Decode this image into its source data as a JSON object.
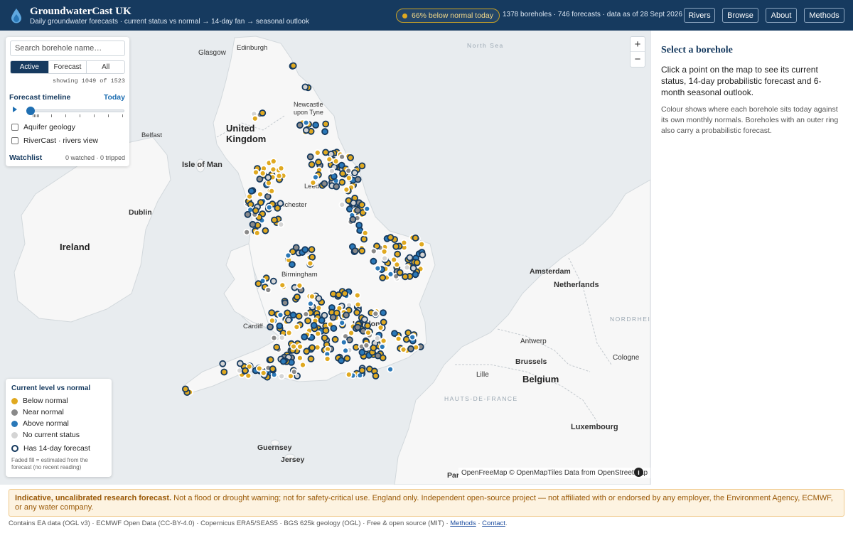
{
  "header": {
    "title": "GroundwaterCast UK",
    "subtitle": "Daily groundwater forecasts · current status vs normal → 14-day fan → seasonal outlook",
    "status_pill": "66% below normal today",
    "stats": "1378 boreholes · 746 forecasts · data as of 28 Sept 2026",
    "nav": [
      "Rivers",
      "Browse",
      "About",
      "Methods"
    ]
  },
  "colors": {
    "brand": "#163a5f",
    "below": "#e0a920",
    "near": "#8a8a8a",
    "above": "#2a78b8",
    "none": "#d4d4d4"
  },
  "panel": {
    "search_placeholder": "Search borehole name…",
    "tabs": [
      "Active",
      "Forecast",
      "All"
    ],
    "active_tab": "Active",
    "showing": "showing 1049 of 1523",
    "timeline_label": "Forecast timeline",
    "today_label": "Today",
    "layers": [
      "Aquifer geology",
      "RiverCast · rivers view"
    ],
    "watchlist_label": "Watchlist",
    "watchlist_counts": "0 watched · 0 tripped"
  },
  "legend": {
    "title": "Current level vs normal",
    "items": [
      "Below normal",
      "Near normal",
      "Above normal",
      "No current status"
    ],
    "ring_label": "Has 14-day forecast",
    "note": "Faded fill = estimated from the forecast (no recent reading)"
  },
  "map": {
    "labels": {
      "edinburgh": "Edinburgh",
      "glasgow": "Glasgow",
      "north_sea": "North Sea",
      "newcastle": "Newcastle upon Tyne",
      "belfast": "Belfast",
      "united_kingdom": "United Kingdom",
      "isle_of_man": "Isle of Man",
      "leeds": "Leeds",
      "manchester": "Manchester",
      "dublin": "Dublin",
      "ireland": "Ireland",
      "birmingham": "Birmingham",
      "amsterdam": "Amsterdam",
      "netherlands": "Netherlands",
      "cardiff": "Cardiff",
      "london": "London",
      "nordrhein": "NORDRHEIN-WESTFALEN",
      "antwerp": "Antwerp",
      "brussels": "Brussels",
      "cologne": "Cologne",
      "lille": "Lille",
      "belgium": "Belgium",
      "hauts_de_france": "HAUTS-DE-FRANCE",
      "luxembourg": "Luxembourg",
      "guernsey": "Guernsey",
      "jersey": "Jersey",
      "paris": "Par"
    },
    "zoom_in": "+",
    "zoom_out": "−",
    "attribution": "OpenFreeMap © OpenMapTiles Data from OpenStreetMap",
    "info": "i"
  },
  "side": {
    "title": "Select a borehole",
    "p1": "Click a point on the map to see its current status, 14-day probabilistic forecast and 6-month seasonal outlook.",
    "p2": "Colour shows where each borehole sits today against its own monthly normals. Boreholes with an outer ring also carry a probabilistic forecast."
  },
  "disclaimer": {
    "bold": "Indicative, uncalibrated research forecast.",
    "text": " Not a flood or drought warning; not for safety-critical use. England only. Independent open-source project — not affiliated with or endorsed by any employer, the Environment Agency, ECMWF, or any water company."
  },
  "footer": {
    "text": "Contains EA data (OGL v3) · ECMWF Open Data (CC-BY-4.0) · Copernicus ERA5/SEAS5 · BGS 625k geology (OGL) · Free & open source (MIT) · ",
    "methods": "Methods",
    "sep": " · ",
    "contact": "Contact",
    "end": "."
  }
}
